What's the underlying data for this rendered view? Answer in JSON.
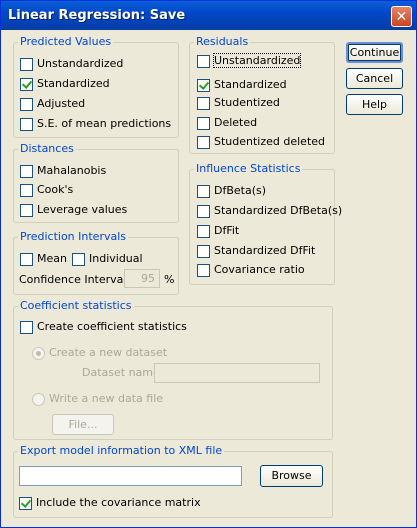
{
  "window": {
    "title": "Linear Regression: Save",
    "close_glyph": "✕"
  },
  "buttons": {
    "continue": "Continue",
    "cancel": "Cancel",
    "help": "Help"
  },
  "predicted_values": {
    "legend": "Predicted Values",
    "items": [
      {
        "label": "Unstandardized",
        "checked": false
      },
      {
        "label": "Standardized",
        "checked": true
      },
      {
        "label": "Adjusted",
        "checked": false
      },
      {
        "label": "S.E. of mean predictions",
        "checked": false
      }
    ]
  },
  "residuals": {
    "legend": "Residuals",
    "items": [
      {
        "label": "Unstandardized",
        "checked": false
      },
      {
        "label": "Standardized",
        "checked": true
      },
      {
        "label": "Studentized",
        "checked": false
      },
      {
        "label": "Deleted",
        "checked": false
      },
      {
        "label": "Studentized deleted",
        "checked": false
      }
    ]
  },
  "distances": {
    "legend": "Distances",
    "items": [
      {
        "label": "Mahalanobis",
        "checked": false
      },
      {
        "label": "Cook's",
        "checked": false
      },
      {
        "label": "Leverage values",
        "checked": false
      }
    ]
  },
  "influence": {
    "legend": "Influence Statistics",
    "items": [
      {
        "label": "DfBeta(s)",
        "checked": false
      },
      {
        "label": "Standardized DfBeta(s)",
        "checked": false
      },
      {
        "label": "DfFit",
        "checked": false
      },
      {
        "label": "Standardized DfFit",
        "checked": false
      },
      {
        "label": "Covariance ratio",
        "checked": false
      }
    ]
  },
  "prediction_intervals": {
    "legend": "Prediction Intervals",
    "mean": {
      "label": "Mean",
      "checked": false
    },
    "individual": {
      "label": "Individual",
      "checked": false
    },
    "ci_label": "Confidence Interval:",
    "ci_value": "95",
    "ci_unit": "%"
  },
  "coefficient": {
    "legend": "Coefficient statistics",
    "create": {
      "label": "Create coefficient statistics",
      "checked": false
    },
    "new_dataset_label": "Create a new dataset",
    "dataset_name_label": "Dataset name:",
    "dataset_name_value": "",
    "write_file_label": "Write a new data file",
    "file_button": "File..."
  },
  "export": {
    "legend": "Export model information to XML file",
    "path_value": "",
    "browse": "Browse",
    "include_cov": {
      "label": "Include the covariance matrix",
      "checked": true
    }
  }
}
